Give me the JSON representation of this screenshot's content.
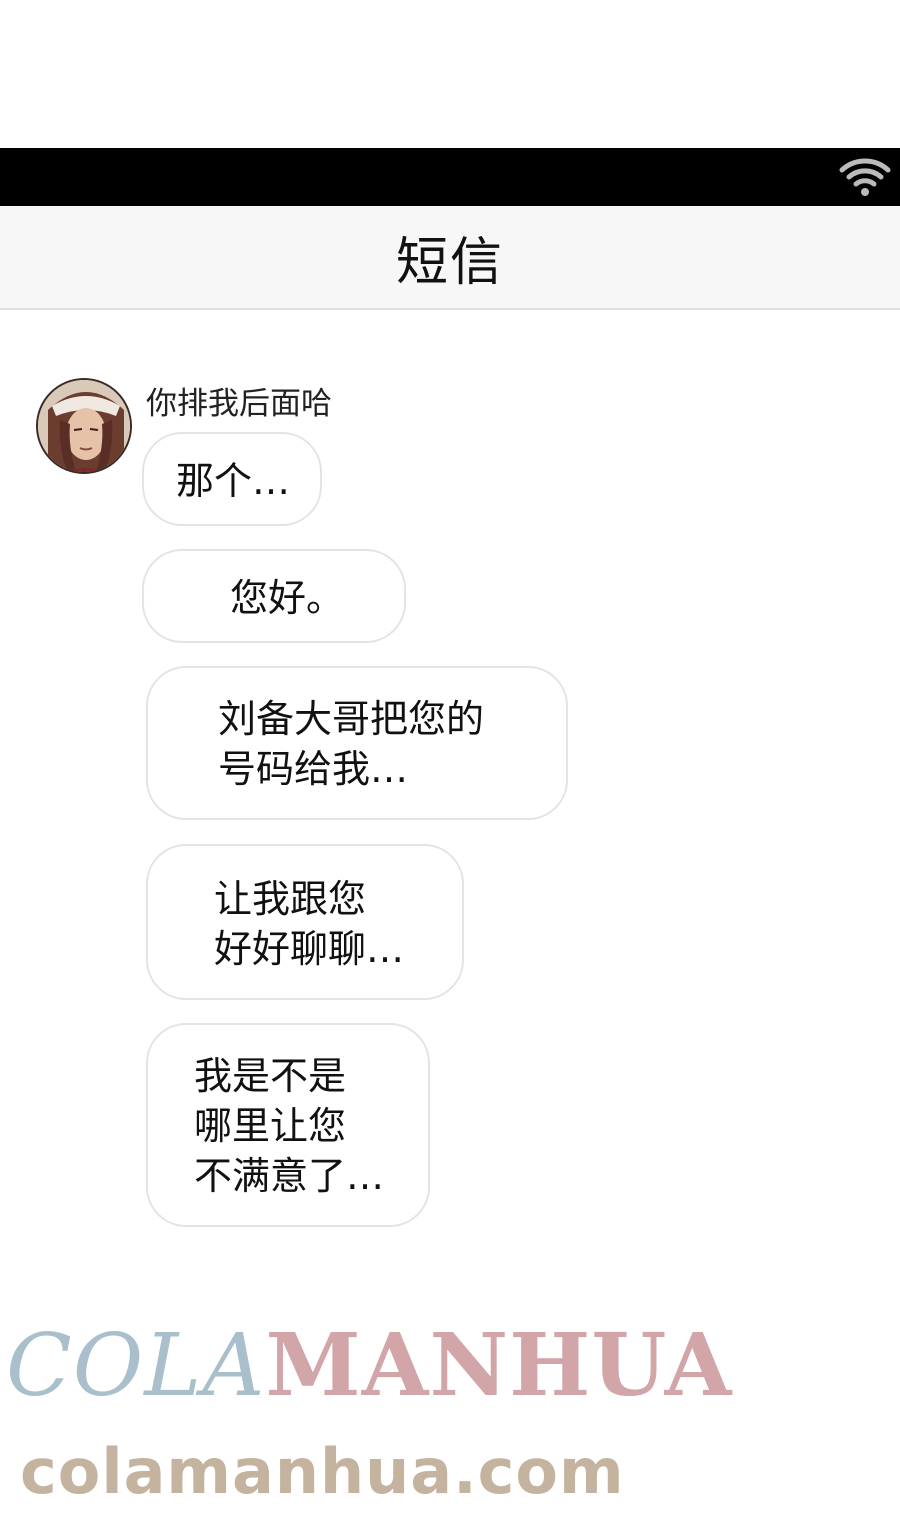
{
  "status_bar": {
    "wifi_icon": "wifi-icon"
  },
  "header": {
    "title": "短信"
  },
  "thread": {
    "sender_name": "你排我后面哈",
    "avatar_icon": "avatar-portrait",
    "messages": [
      "那个…",
      "您好。",
      "刘备大哥把您的\n号码给我…",
      "让我跟您\n好好聊聊…",
      "我是不是\n哪里让您\n不满意了…"
    ]
  },
  "watermark": {
    "part1": "COLA",
    "part2": "MANHUA",
    "url": "colamanhua.com"
  },
  "colors": {
    "status_bar": "#000000",
    "header_bg": "#f7f7f7",
    "bubble_border": "#e4e4e4",
    "watermark_blue": "#a9bfcc",
    "watermark_pink": "#d2a5a8",
    "watermark_tan": "#c4b39e"
  }
}
